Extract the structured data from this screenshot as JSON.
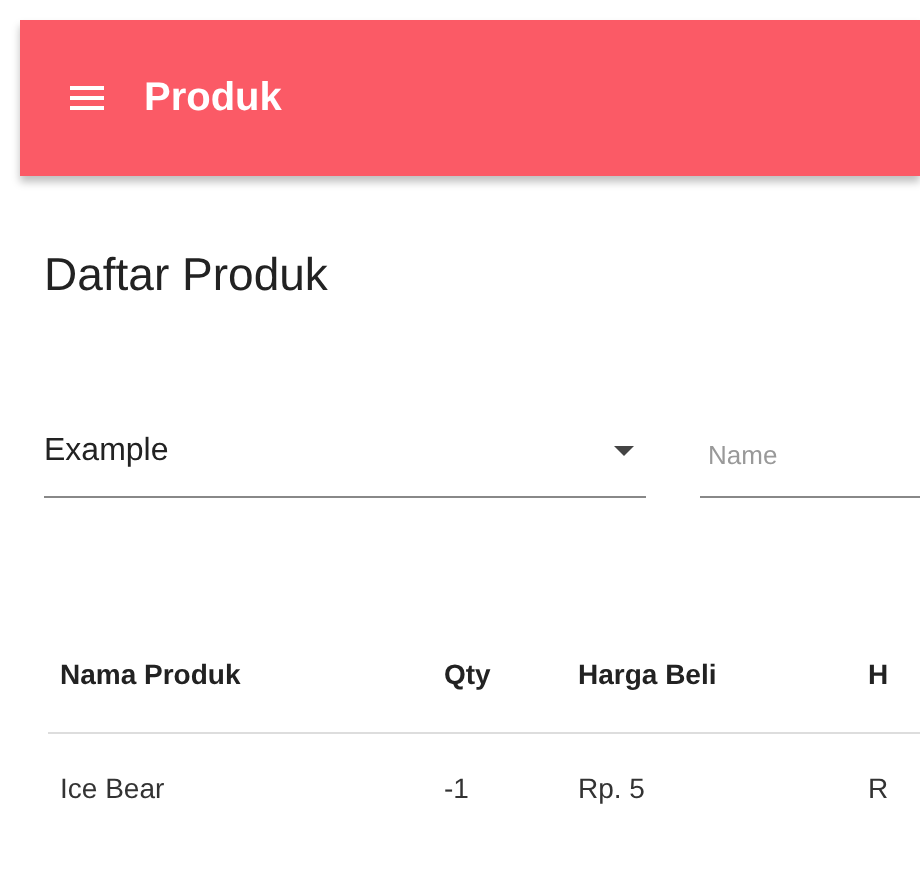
{
  "app_bar": {
    "title": "Produk"
  },
  "page_title": "Daftar Produk",
  "filters": {
    "select": {
      "value": "Example"
    },
    "name_field": {
      "placeholder": "Name"
    }
  },
  "table": {
    "columns": [
      "Nama Produk",
      "Qty",
      "Harga Beli",
      "H"
    ],
    "rows": [
      [
        "Ice Bear",
        "-1",
        "Rp. 5",
        "R"
      ]
    ]
  }
}
